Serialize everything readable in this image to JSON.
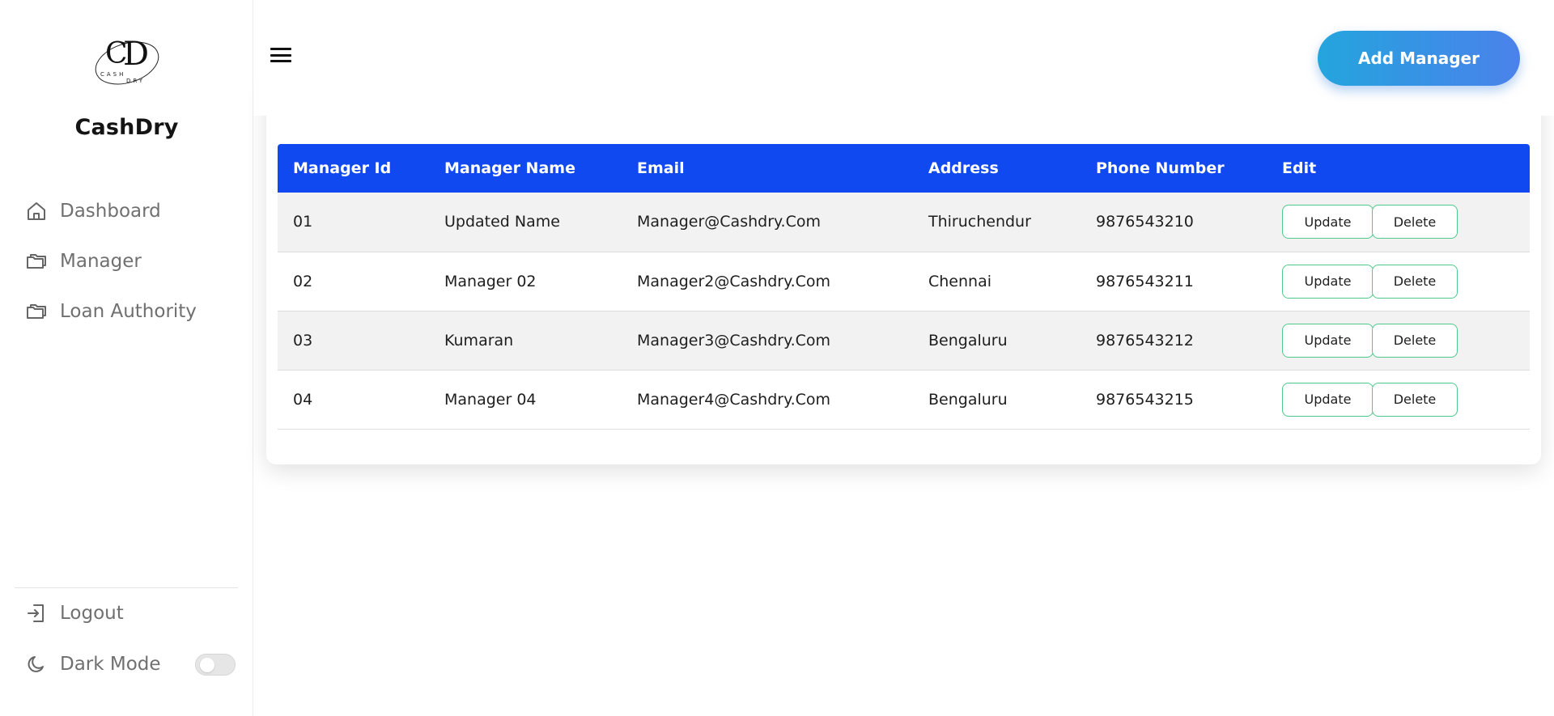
{
  "brand": {
    "name": "CashDry",
    "logo_text": "CD",
    "logo_subtext": "CASH DRY"
  },
  "sidebar": {
    "items": [
      {
        "label": "Dashboard",
        "icon": "home-icon"
      },
      {
        "label": "Manager",
        "icon": "folders-icon"
      },
      {
        "label": "Loan Authority",
        "icon": "folders-icon"
      }
    ],
    "logout": {
      "label": "Logout",
      "icon": "logout-icon"
    },
    "dark_mode": {
      "label": "Dark Mode",
      "icon": "moon-icon",
      "enabled": false
    }
  },
  "header": {
    "menu_icon": "hamburger-icon",
    "add_button": "Add Manager"
  },
  "table": {
    "columns": [
      "Manager Id",
      "Manager Name",
      "Email",
      "Address",
      "Phone Number",
      "Edit"
    ],
    "rows": [
      {
        "id": "01",
        "name": "Updated Name",
        "email": "Manager@Cashdry.Com",
        "address": "Thiruchendur",
        "phone": "9876543210"
      },
      {
        "id": "02",
        "name": "Manager 02",
        "email": "Manager2@Cashdry.Com",
        "address": "Chennai",
        "phone": "9876543211"
      },
      {
        "id": "03",
        "name": "Kumaran",
        "email": "Manager3@Cashdry.Com",
        "address": "Bengaluru",
        "phone": "9876543212"
      },
      {
        "id": "04",
        "name": "Manager 04",
        "email": "Manager4@Cashdry.Com",
        "address": "Bengaluru",
        "phone": "9876543215"
      }
    ],
    "update_label": "Update",
    "delete_label": "Delete"
  },
  "colors": {
    "table_header": "#1149f0",
    "button_gradient_start": "#24a5dd",
    "button_gradient_end": "#4b82ea",
    "action_border": "#4fc98a"
  }
}
